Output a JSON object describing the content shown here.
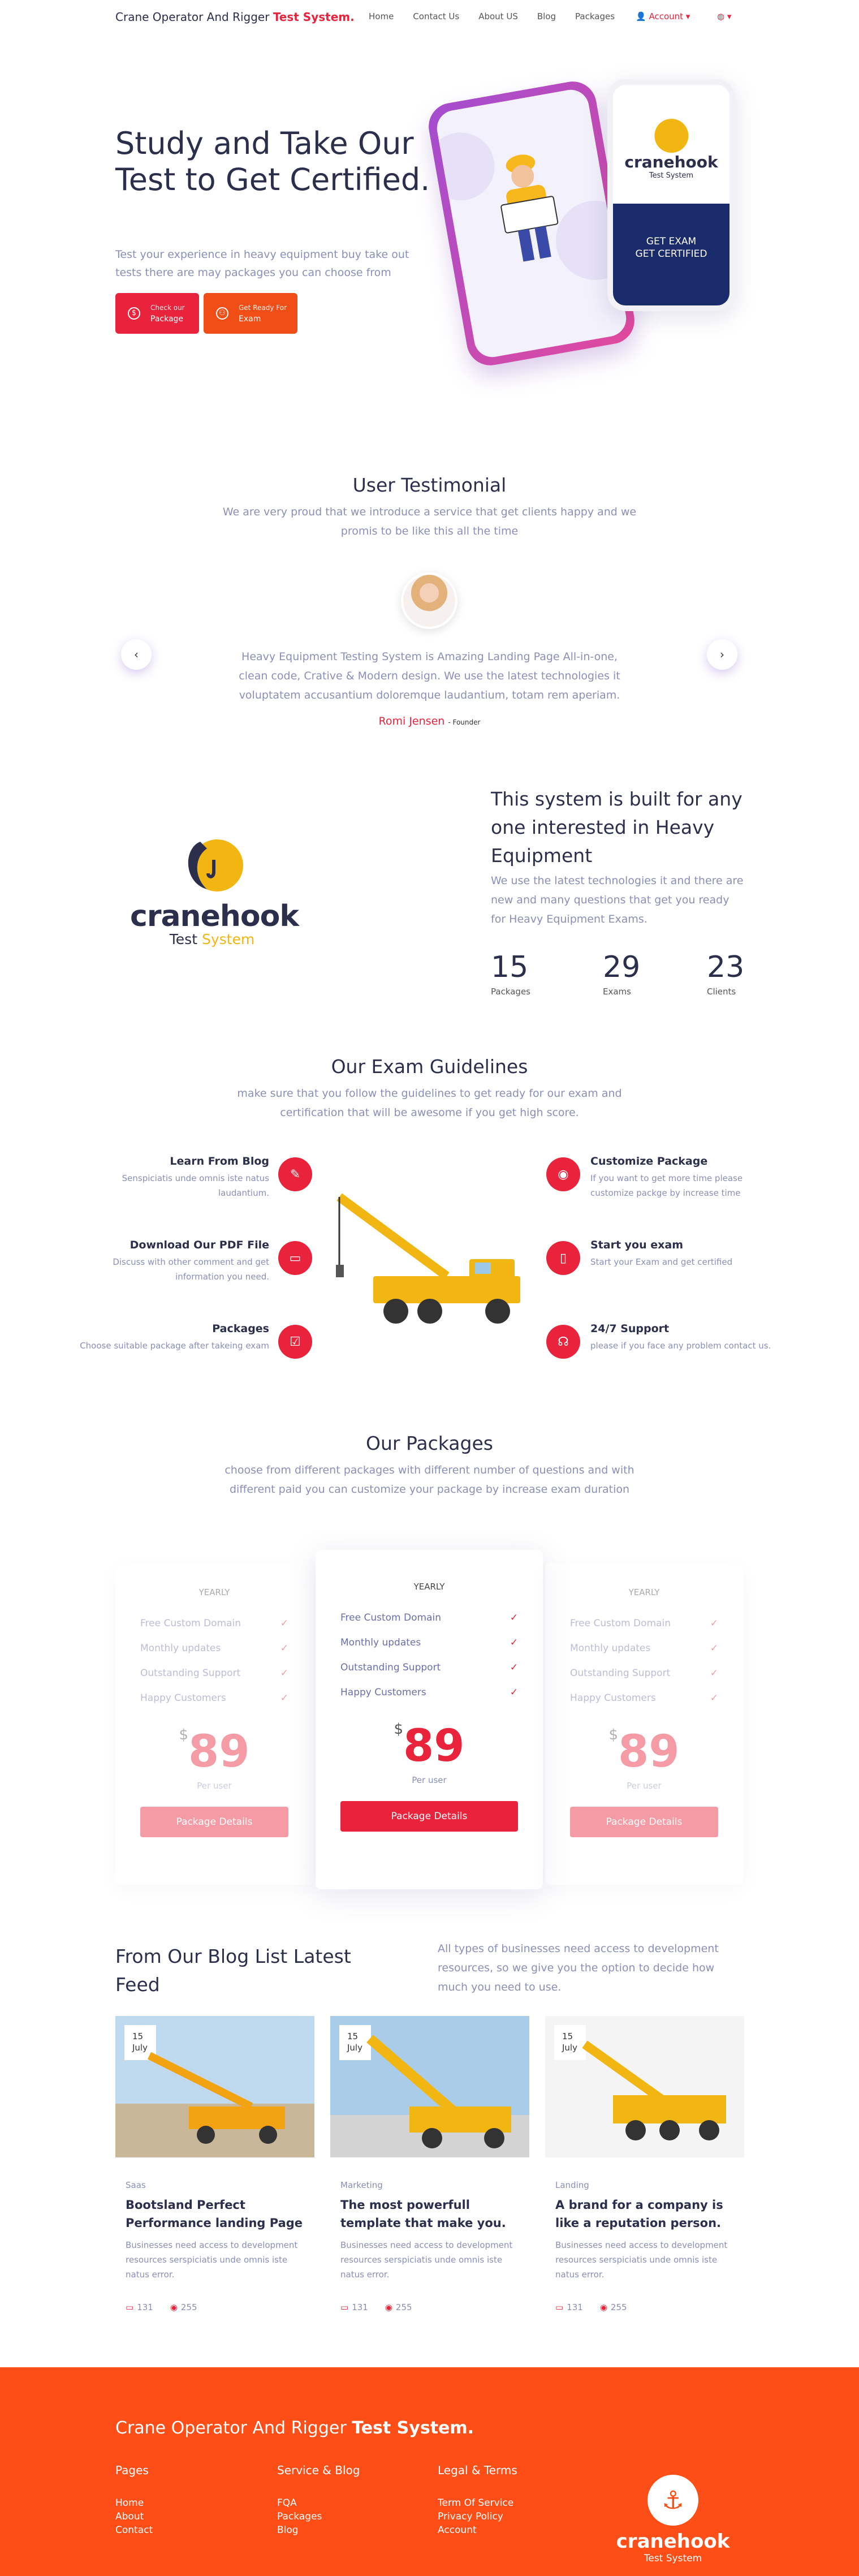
{
  "nav": {
    "brand_prefix": "Crane Operator And Rigger",
    "brand_bold": "Test System.",
    "links": [
      "Home",
      "Contact Us",
      "About US",
      "Blog",
      "Packages"
    ],
    "account": "Account ▾",
    "lang": "◍ ▾"
  },
  "hero": {
    "title": "Study and Take Our Test to Get Certified.",
    "subtitle": "Test your experience in heavy equipment buy take out tests there are may packages you can choose from",
    "btn1_small": "Check our",
    "btn1_label": "Package",
    "btn2_small": "Get Ready For",
    "btn2_label": "Exam",
    "phone_logo": "cranehook",
    "phone_tag": "Test System",
    "phone_exam": "GET EXAM\nGET CERTIFIED"
  },
  "testimonial": {
    "title": "User Testimonial",
    "subtitle": "We are very proud that we introduce a service that get clients happy and we promis to be like this all the time",
    "quote": "Heavy Equipment Testing System is Amazing Landing Page All-in-one, clean code, Crative & Modern design. We use the latest technologies it voluptatem accusantium doloremque laudantium, totam rem aperiam.",
    "author": "Romi Jensen",
    "role": "- Founder"
  },
  "about": {
    "logo_name": "cranehook",
    "logo_tag_a": "Test",
    "logo_tag_b": "System",
    "title": "This system is built for any one interested in Heavy Equipment",
    "subtitle": "We use the latest technologies it and there are new and many questions that get you ready for Heavy Equipment Exams.",
    "stats": [
      {
        "value": "15",
        "label": "Packages"
      },
      {
        "value": "29",
        "label": "Exams"
      },
      {
        "value": "23",
        "label": "Clients"
      }
    ]
  },
  "guidelines": {
    "title": "Our Exam Guidelines",
    "subtitle": "make sure that you follow the guidelines to get ready for our exam and certification that will be awesome if you get high score.",
    "left": [
      {
        "title": "Learn From Blog",
        "text": "Senspiciatis unde omnis iste natus laudantium."
      },
      {
        "title": "Download Our PDF File",
        "text": "Discuss with other comment and get information you need."
      },
      {
        "title": "Packages",
        "text": "Choose suitable package after takeing exam"
      }
    ],
    "right": [
      {
        "title": "Customize Package",
        "text": "If you want to get more time please customize packge by increase time"
      },
      {
        "title": "Start you exam",
        "text": "Start your Exam and get certified"
      },
      {
        "title": "24/7 Support",
        "text": "please if you face any problem contact us."
      }
    ]
  },
  "packages": {
    "title": "Our Packages",
    "subtitle": "choose from different packages with different number of questions and with different paid you can customize your package by increase exam duration",
    "items": [
      {
        "period": "YEARLY",
        "features": [
          "Free Custom Domain",
          "Monthly updates",
          "Outstanding Support",
          "Happy Customers"
        ],
        "currency": "$",
        "price": "89",
        "per": "Per user",
        "button": "Package Details"
      },
      {
        "period": "YEARLY",
        "features": [
          "Free Custom Domain",
          "Monthly updates",
          "Outstanding Support",
          "Happy Customers"
        ],
        "currency": "$",
        "price": "89",
        "per": "Per user",
        "button": "Package Details"
      },
      {
        "period": "YEARLY",
        "features": [
          "Free Custom Domain",
          "Monthly updates",
          "Outstanding Support",
          "Happy Customers"
        ],
        "currency": "$",
        "price": "89",
        "per": "Per user",
        "button": "Package Details"
      }
    ]
  },
  "blog": {
    "title": "From Our Blog List Latest Feed",
    "subtitle": "All types of businesses need access to development resources, so we give you the option to decide how much you need to use.",
    "posts": [
      {
        "day": "15",
        "month": "July",
        "category": "Saas",
        "title": "Bootsland Perfect Performance landing Page",
        "text": "Businesses need access to development resources serspiciatis unde omnis iste natus error.",
        "comments": "131",
        "views": "255"
      },
      {
        "day": "15",
        "month": "July",
        "category": "Marketing",
        "title": "The most powerfull template that make you.",
        "text": "Businesses need access to development resources serspiciatis unde omnis iste natus error.",
        "comments": "131",
        "views": "255"
      },
      {
        "day": "15",
        "month": "July",
        "category": "Landing",
        "title": "A brand for a company is like a reputation person.",
        "text": "Businesses need access to development resources serspiciatis unde omnis iste natus error.",
        "comments": "131",
        "views": "255"
      }
    ]
  },
  "footer": {
    "title_prefix": "Crane Operator And Rigger",
    "title_bold": "Test System.",
    "columns": [
      {
        "heading": "Pages",
        "items": [
          "Home",
          "About",
          "Contact"
        ]
      },
      {
        "heading": "Service & Blog",
        "items": [
          "FQA",
          "Packages",
          "Blog"
        ]
      },
      {
        "heading": "Legal & Terms",
        "items": [
          "Term Of Service",
          "Privacy Policy",
          "Account"
        ]
      }
    ],
    "logo_name": "cranehook",
    "logo_tag": "Test System"
  },
  "colors": {
    "accent": "#e8233b",
    "orange": "#fc4e16",
    "text": "#2b2f4c",
    "muted": "#8a8fb8"
  }
}
